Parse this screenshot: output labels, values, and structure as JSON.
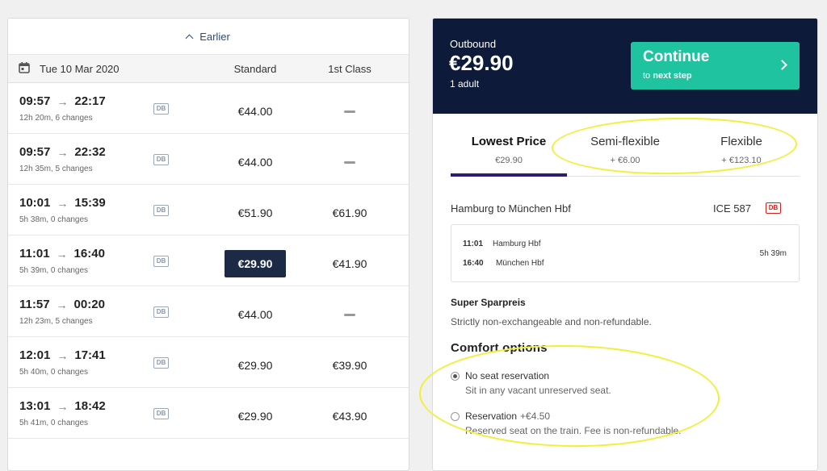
{
  "left": {
    "earlier_label": "Earlier",
    "date": "Tue 10 Mar 2020",
    "col_standard": "Standard",
    "col_first": "1st Class",
    "rows": [
      {
        "dep": "09:57",
        "arr": "22:17",
        "meta": "12h 20m, 6 changes",
        "std": "€44.00",
        "first": null,
        "selected": false
      },
      {
        "dep": "09:57",
        "arr": "22:32",
        "meta": "12h 35m, 5 changes",
        "std": "€44.00",
        "first": null,
        "selected": false
      },
      {
        "dep": "10:01",
        "arr": "15:39",
        "meta": "5h 38m, 0 changes",
        "std": "€51.90",
        "first": "€61.90",
        "selected": false
      },
      {
        "dep": "11:01",
        "arr": "16:40",
        "meta": "5h 39m, 0 changes",
        "std": "€29.90",
        "first": "€41.90",
        "selected": true
      },
      {
        "dep": "11:57",
        "arr": "00:20",
        "meta": "12h 23m, 5 changes",
        "std": "€44.00",
        "first": null,
        "selected": false
      },
      {
        "dep": "12:01",
        "arr": "17:41",
        "meta": "5h 40m, 0 changes",
        "std": "€29.90",
        "first": "€39.90",
        "selected": false
      },
      {
        "dep": "13:01",
        "arr": "18:42",
        "meta": "5h 41m, 0 changes",
        "std": "€29.90",
        "first": "€43.90",
        "selected": false
      }
    ],
    "operator_badge": "DB"
  },
  "right": {
    "outbound_label": "Outbound",
    "amount": "€29.90",
    "passengers": "1 adult",
    "continue_title": "Continue",
    "continue_sub_prefix": "to",
    "continue_sub_bold": "next step",
    "tabs": [
      {
        "name": "Lowest Price",
        "price": "€29.90",
        "active": true
      },
      {
        "name": "Semi-flexible",
        "price": "+ €6.00",
        "active": false
      },
      {
        "name": "Flexible",
        "price": "+ €123.10",
        "active": false
      }
    ],
    "route": "Hamburg to München Hbf",
    "train": "ICE 587",
    "operator_badge": "DB",
    "stops": {
      "dep_time": "11:01",
      "dep_station": "Hamburg Hbf",
      "arr_time": "16:40",
      "arr_station": "München Hbf",
      "duration": "5h 39m"
    },
    "fare_name": "Super Sparpreis",
    "fare_desc": "Strictly non-exchangeable and non-refundable.",
    "comfort_title": "Comfort options",
    "options": [
      {
        "title": "No seat reservation",
        "fee": "",
        "desc": "Sit in any vacant unreserved seat.",
        "selected": true
      },
      {
        "title": "Reservation",
        "fee": "+€4.50",
        "desc": "Reserved seat on the train. Fee is non-refundable.",
        "selected": false
      }
    ]
  },
  "colors": {
    "navy": "#0e1a3a",
    "teal": "#1fc3a0",
    "selected_price": "#1d2a45",
    "tab_underline": "#2e1c6e",
    "highlight": "#f2ef3a",
    "db_red": "#d0211c"
  }
}
